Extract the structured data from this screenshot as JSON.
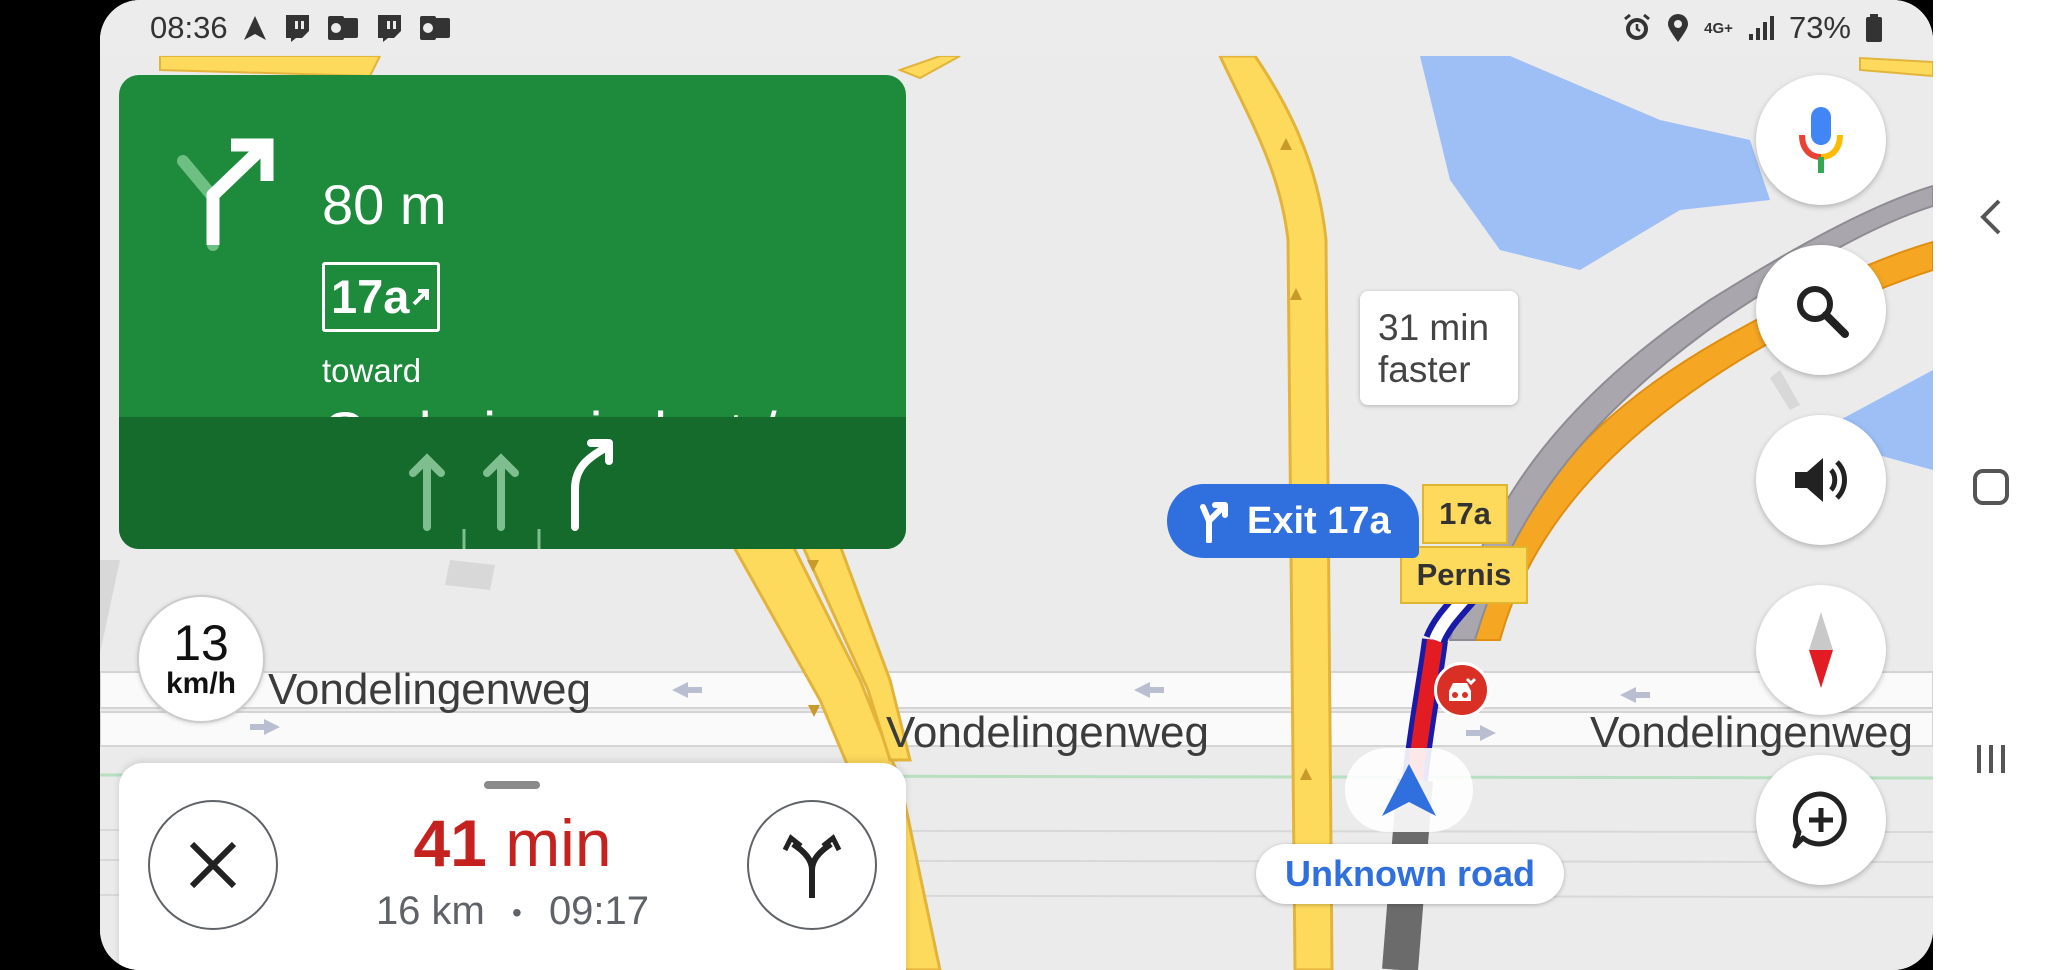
{
  "status_bar": {
    "time": "08:36",
    "network": "4G+",
    "battery": "73%"
  },
  "direction": {
    "distance": "80 m",
    "exit_number": "17a",
    "toward_label": "toward",
    "destination": "Gaderingviaduct / ..."
  },
  "speed": {
    "value": "13",
    "unit": "km/h"
  },
  "eta": {
    "duration_value": "41",
    "duration_unit": "min",
    "distance": "16 km",
    "separator": "•",
    "arrival": "09:17"
  },
  "map": {
    "faster_line1": "31 min",
    "faster_line2": "faster",
    "exit_pill": "Exit 17a",
    "shield_exit": "17a",
    "shield_place": "Pernis",
    "road_label_1": "Vondelingenweg",
    "road_label_2": "Vondelingenweg",
    "road_label_3": "Vondelingenweg",
    "current_road": "Unknown road"
  },
  "buttons": {
    "voice": "microphone-icon",
    "search": "search-icon",
    "sound": "speaker-icon",
    "compass": "compass-icon",
    "add_report": "add-report-icon",
    "close": "close-icon",
    "alternates": "route-options-icon"
  },
  "colors": {
    "guidance_green": "#1e8a3c",
    "lane_green": "#156b2c",
    "eta_red": "#c5221f",
    "route_blue": "#2f6fde",
    "road_yellow": "#fdd95c"
  }
}
